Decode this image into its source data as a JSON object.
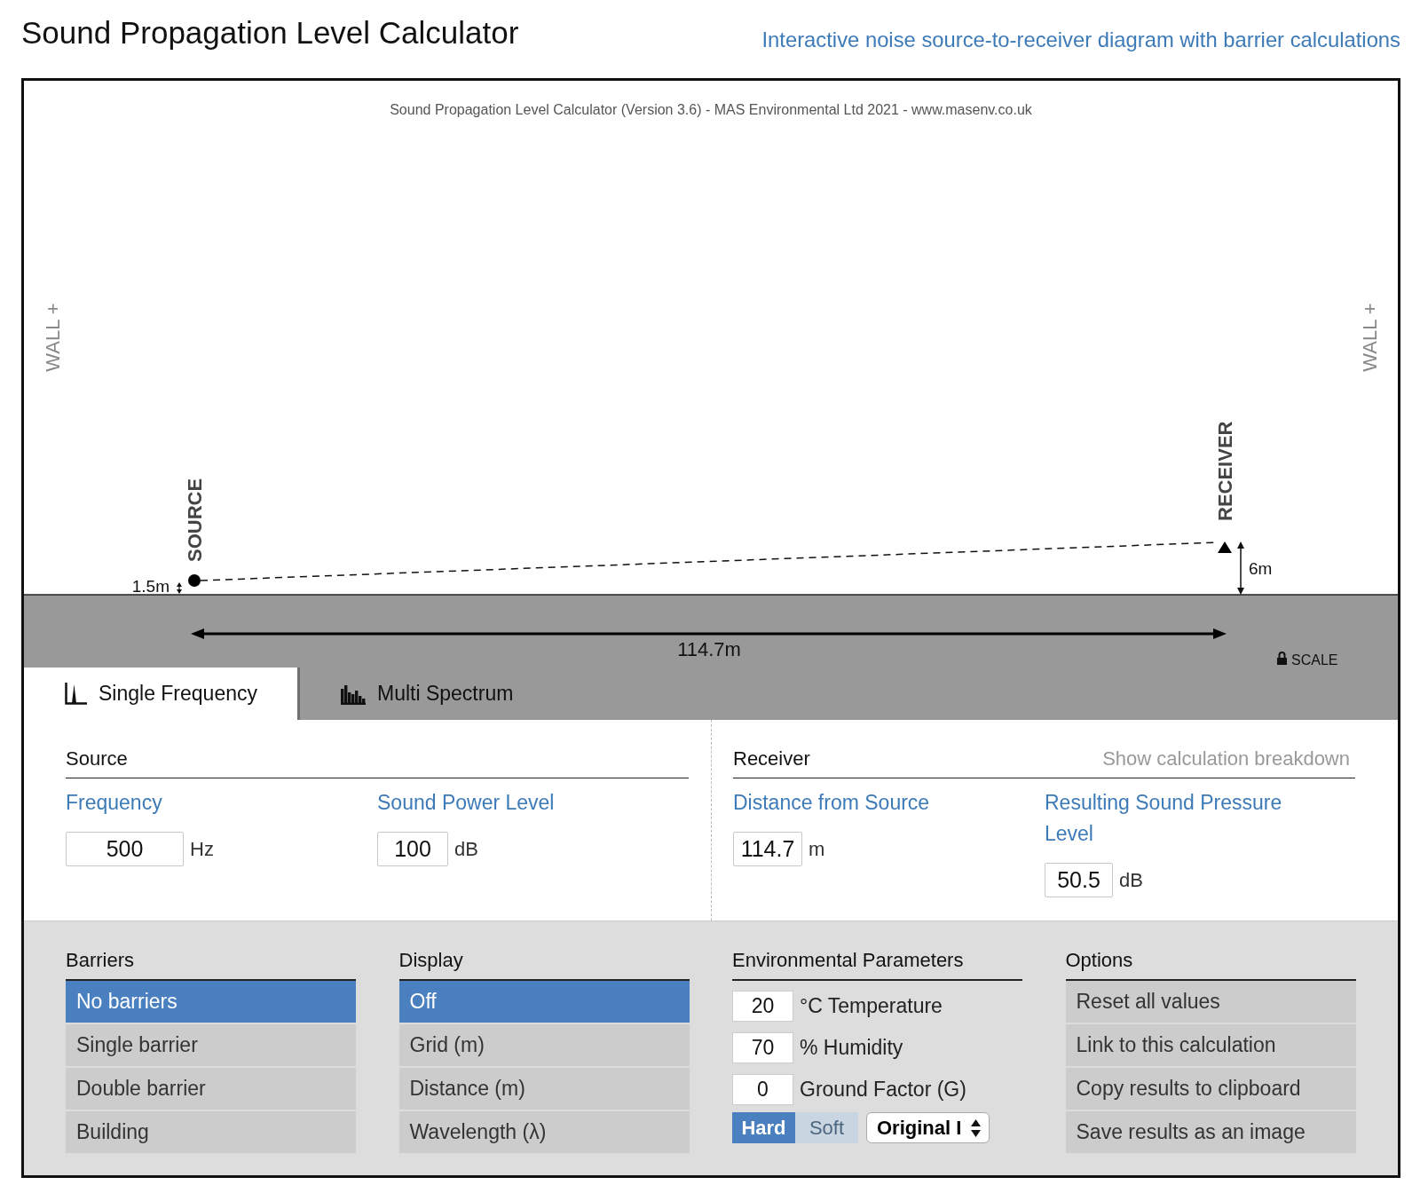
{
  "header": {
    "title": "Sound Propagation Level Calculator",
    "subtitle": "Interactive noise source-to-receiver diagram with barrier calculations"
  },
  "diagram": {
    "credit": "Sound Propagation Level Calculator (Version 3.6) - MAS Environmental Ltd 2021 - www.masenv.co.uk",
    "walls": [
      "WALL +",
      "WALL +"
    ],
    "source": {
      "label": "SOURCE",
      "height": "1.5m"
    },
    "receiver": {
      "label": "RECEIVER",
      "height": "6m"
    },
    "distance": "114.7m",
    "scale": {
      "label": "SCALE",
      "locked": true
    }
  },
  "tabs": [
    {
      "label": "Single Frequency",
      "kind": "single",
      "selected": true
    },
    {
      "label": "Multi Spectrum",
      "kind": "multi",
      "selected": false
    }
  ],
  "source_panel": {
    "title": "Source",
    "fields": [
      {
        "label": "Frequency",
        "value": "500",
        "unit": "Hz"
      },
      {
        "label": "Sound Power Level",
        "value": "100",
        "unit": "dB"
      }
    ]
  },
  "receiver_panel": {
    "title": "Receiver",
    "link": "Show calculation breakdown",
    "fields": [
      {
        "label": "Distance from Source",
        "value": "114.7",
        "unit": "m"
      },
      {
        "label": "Resulting Sound Pressure Level",
        "value": "50.5",
        "unit": "dB"
      }
    ]
  },
  "barriers": {
    "title": "Barriers",
    "items": [
      {
        "label": "No barriers",
        "selected": true
      },
      {
        "label": "Single barrier",
        "selected": false
      },
      {
        "label": "Double barrier",
        "selected": false
      },
      {
        "label": "Building",
        "selected": false
      }
    ]
  },
  "display": {
    "title": "Display",
    "items": [
      {
        "label": "Off",
        "selected": true
      },
      {
        "label": "Grid (m)",
        "selected": false
      },
      {
        "label": "Distance (m)",
        "selected": false
      },
      {
        "label": "Wavelength (λ)",
        "selected": false
      }
    ]
  },
  "environment": {
    "title": "Environmental Parameters",
    "fields": [
      {
        "value": "20",
        "label": "°C Temperature"
      },
      {
        "value": "70",
        "label": "% Humidity"
      },
      {
        "value": "0",
        "label": "Ground Factor (G)"
      }
    ],
    "ground_types": [
      {
        "label": "Hard",
        "selected": true
      },
      {
        "label": "Soft",
        "selected": false
      }
    ],
    "model": "Original I"
  },
  "options": {
    "title": "Options",
    "items": [
      {
        "label": "Reset all values"
      },
      {
        "label": "Link to this calculation"
      },
      {
        "label": "Copy results to clipboard"
      },
      {
        "label": "Save results as an image"
      }
    ]
  }
}
